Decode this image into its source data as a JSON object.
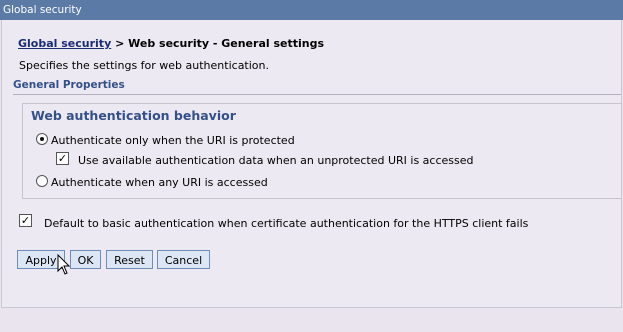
{
  "window": {
    "title": "Global security"
  },
  "breadcrumb": {
    "link": "Global security",
    "rest": " > Web security - General settings"
  },
  "description": "Specifies the settings for web authentication.",
  "section_title": "General Properties",
  "group": {
    "legend": "Web authentication behavior",
    "option_protected": "Authenticate only when the URI is protected",
    "option_use_available": "Use available authentication data when an unprotected URI is accessed",
    "option_any": "Authenticate when any URI is accessed"
  },
  "default_basic": "Default to basic authentication when certificate authentication for the HTTPS client fails",
  "buttons": {
    "apply": "Apply",
    "ok": "OK",
    "reset": "Reset",
    "cancel": "Cancel"
  }
}
